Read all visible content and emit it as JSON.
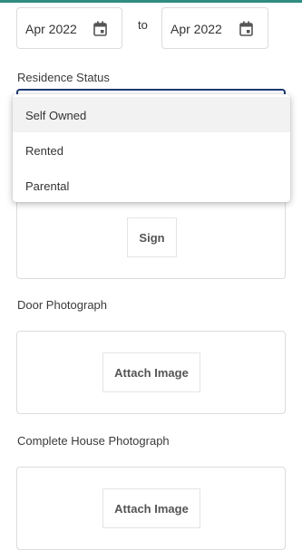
{
  "date_range": {
    "from_value": "Apr 2022",
    "separator": "to",
    "to_value": "Apr 2022"
  },
  "residence": {
    "label": "Residence Status",
    "options": [
      "Self Owned",
      "Rented",
      "Parental"
    ],
    "highlighted": "Self Owned"
  },
  "signature": {
    "button_label": "Sign"
  },
  "door_photo": {
    "label": "Door Photograph",
    "button_label": "Attach Image"
  },
  "house_photo": {
    "label": "Complete House Photograph",
    "button_label": "Attach Image"
  },
  "colors": {
    "accent_bar": "#2f8c7f",
    "focus_border": "#1f3b73"
  }
}
